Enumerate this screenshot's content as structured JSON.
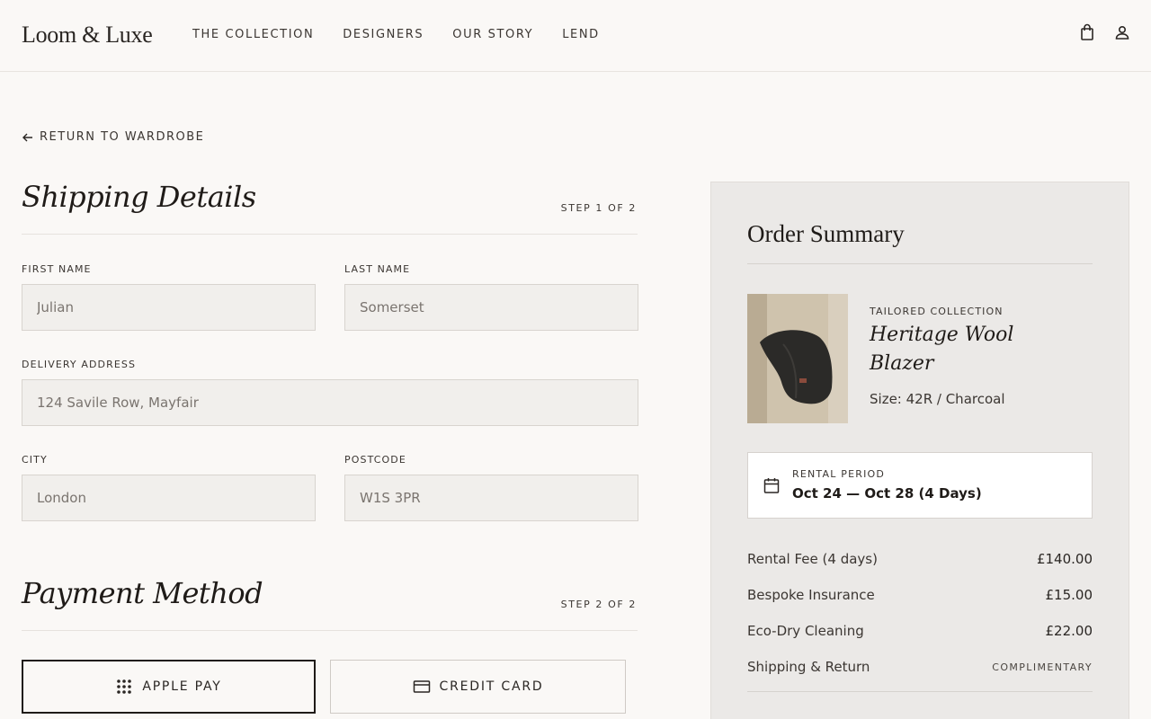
{
  "brand": {
    "logo": "Loom & Luxe"
  },
  "nav": {
    "items": [
      {
        "label": "THE COLLECTION"
      },
      {
        "label": "DESIGNERS"
      },
      {
        "label": "OUR STORY"
      },
      {
        "label": "LEND"
      }
    ],
    "icons": [
      "shopping-bag-icon",
      "user-icon"
    ]
  },
  "back_link": {
    "label": "RETURN TO WARDROBE",
    "icon": "arrow-left-icon"
  },
  "shipping": {
    "title": "Shipping Details",
    "step": "STEP 1 OF 2",
    "first_name": {
      "label": "FIRST NAME",
      "value": "Julian"
    },
    "last_name": {
      "label": "LAST NAME",
      "value": "Somerset"
    },
    "address": {
      "label": "DELIVERY ADDRESS",
      "value": "124 Savile Row, Mayfair"
    },
    "city": {
      "label": "CITY",
      "value": "London"
    },
    "postcode": {
      "label": "POSTCODE",
      "value": "W1S 3PR"
    }
  },
  "payment": {
    "title": "Payment Method",
    "step": "STEP 2 OF 2",
    "options": [
      {
        "label": "APPLE PAY",
        "icon": "dots-grid-icon",
        "selected": true
      },
      {
        "label": "CREDIT CARD",
        "icon": "credit-card-icon",
        "selected": false
      }
    ]
  },
  "summary": {
    "title": "Order Summary",
    "product": {
      "eyebrow": "TAILORED COLLECTION",
      "name": "Heritage Wool Blazer",
      "size": "Size: 42R / Charcoal"
    },
    "rental": {
      "label": "RENTAL PERIOD",
      "dates": "Oct 24 — Oct 28 (4 Days)",
      "icon": "calendar-icon"
    },
    "line_items": [
      {
        "label": "Rental Fee (4 days)",
        "amount": "£140.00"
      },
      {
        "label": "Bespoke Insurance",
        "amount": "£15.00"
      },
      {
        "label": "Eco-Dry Cleaning",
        "amount": "£22.00"
      },
      {
        "label": "Shipping & Return",
        "amount": "COMPLIMENTARY"
      }
    ]
  },
  "colors": {
    "background": "#faf8f6",
    "panel": "#ebe9e7",
    "field": "#f1efec",
    "text": "#2a2623",
    "selected_border": "#1f1b18"
  }
}
